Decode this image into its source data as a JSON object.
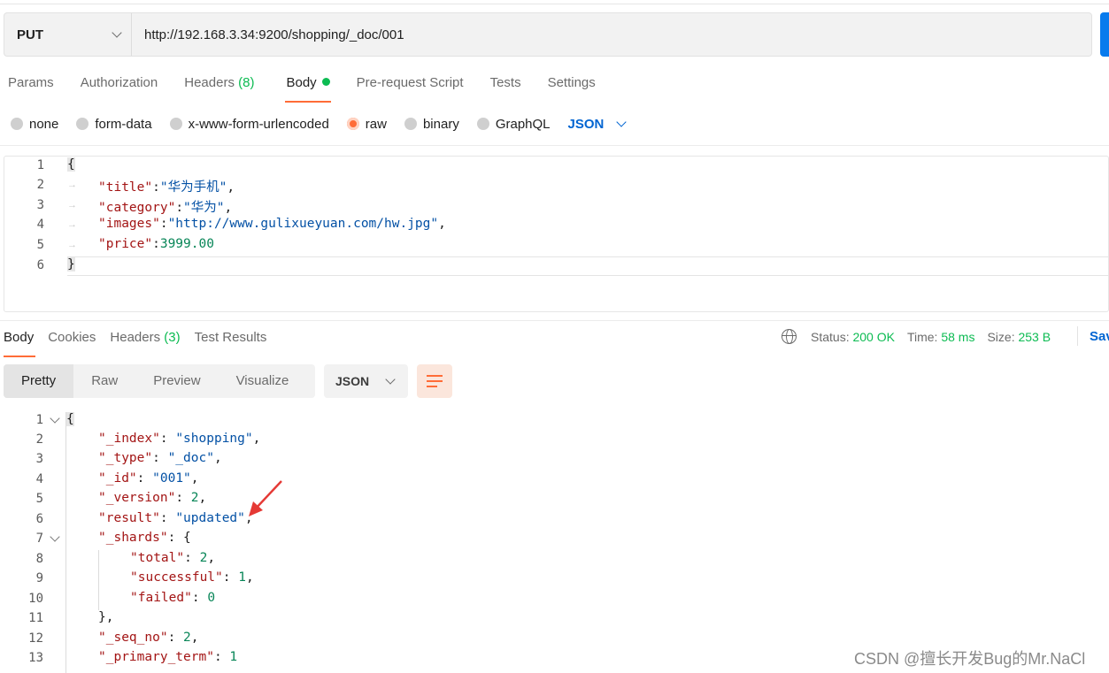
{
  "request": {
    "method": "PUT",
    "url": "http://192.168.3.34:9200/shopping/_doc/001"
  },
  "request_tabs": [
    {
      "label": "Params"
    },
    {
      "label": "Authorization"
    },
    {
      "label": "Headers",
      "count": "(8)"
    },
    {
      "label": "Body"
    },
    {
      "label": "Pre-request Script"
    },
    {
      "label": "Tests"
    },
    {
      "label": "Settings"
    }
  ],
  "body_types": [
    "none",
    "form-data",
    "x-www-form-urlencoded",
    "raw",
    "binary",
    "GraphQL"
  ],
  "body_format": "JSON",
  "request_body": {
    "line_numbers": [
      "1",
      "2",
      "3",
      "4",
      "5",
      "6"
    ],
    "open_brace": "{",
    "close_brace": "}",
    "fields": [
      {
        "key": "\"title\"",
        "sep": ":",
        "value": "\"华为手机\"",
        "tail": ","
      },
      {
        "key": "\"category\"",
        "sep": ":",
        "value": "\"华为\"",
        "tail": ","
      },
      {
        "key": "\"images\"",
        "sep": ":",
        "value": "\"http://www.gulixueyuan.com/hw.jpg\"",
        "tail": ","
      },
      {
        "key": "\"price\"",
        "sep": ":",
        "value": "3999.00",
        "tail": ""
      }
    ]
  },
  "response_tabs": [
    {
      "label": "Body"
    },
    {
      "label": "Cookies"
    },
    {
      "label": "Headers",
      "count": "(3)"
    },
    {
      "label": "Test Results"
    }
  ],
  "response_status": {
    "status_label": "Status:",
    "status_value": "200 OK",
    "time_label": "Time:",
    "time_value": "58 ms",
    "size_label": "Size:",
    "size_value": "253 B",
    "save_label": "Sav"
  },
  "view_modes": [
    "Pretty",
    "Raw",
    "Preview",
    "Visualize"
  ],
  "response_format": "JSON",
  "response_body": {
    "line_numbers": [
      "1",
      "2",
      "3",
      "4",
      "5",
      "6",
      "7",
      "8",
      "9",
      "10",
      "11",
      "12",
      "13"
    ],
    "open_brace": "{",
    "index_key": "\"_index\"",
    "index_val": "\"shopping\"",
    "type_key": "\"_type\"",
    "type_val": "\"_doc\"",
    "id_key": "\"_id\"",
    "id_val": "\"001\"",
    "version_key": "\"_version\"",
    "version_val": "2",
    "result_key": "\"result\"",
    "result_val": "\"updated\"",
    "shards_key": "\"_shards\"",
    "shards_open": "{",
    "total_key": "\"total\"",
    "total_val": "2",
    "successful_key": "\"successful\"",
    "successful_val": "1",
    "failed_key": "\"failed\"",
    "failed_val": "0",
    "shards_close": "},",
    "seq_key": "\"_seq_no\"",
    "seq_val": "2",
    "term_key": "\"_primary_term\"",
    "term_val": "1"
  },
  "watermark": "CSDN @擅长开发Bug的Mr.NaCl",
  "colors": {
    "accent": "#ff6c37",
    "success": "#0cbb52",
    "link": "#0265d2"
  }
}
